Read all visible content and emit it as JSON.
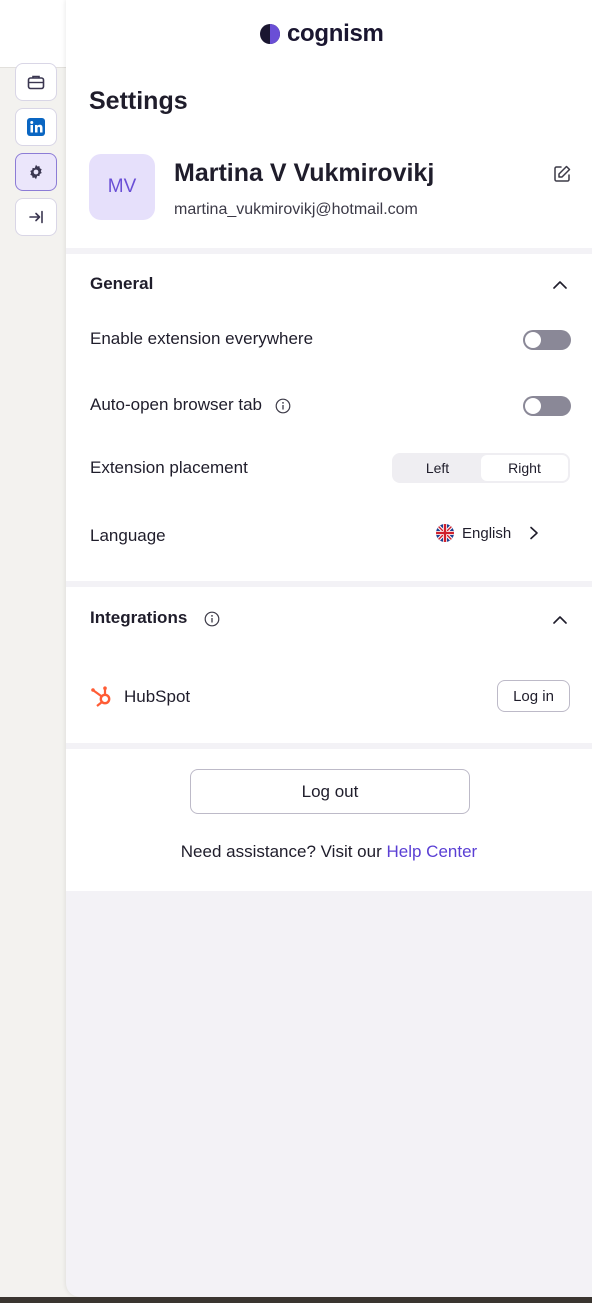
{
  "brand": {
    "name": "cognism",
    "accent": "#6a4fd6"
  },
  "toolbar": {
    "items": [
      {
        "icon": "briefcase-icon"
      },
      {
        "icon": "linkedin-icon"
      },
      {
        "icon": "gear-icon",
        "active": true
      },
      {
        "icon": "collapse-right-icon"
      }
    ]
  },
  "header": {
    "title": "Settings",
    "user": {
      "initials": "MV",
      "name": "Martina V Vukmirovikj",
      "email": "martina_vukmirovikj@hotmail.com"
    }
  },
  "general": {
    "title": "General",
    "enable_everywhere": {
      "label": "Enable extension everywhere",
      "on": false
    },
    "auto_open": {
      "label": "Auto-open browser tab",
      "on": false
    },
    "placement": {
      "label": "Extension placement",
      "options": [
        "Left",
        "Right"
      ],
      "selected": "Right"
    },
    "language": {
      "label": "Language",
      "value": "English"
    }
  },
  "integrations": {
    "title": "Integrations",
    "hubspot": {
      "name": "HubSpot",
      "login_label": "Log in"
    }
  },
  "footer": {
    "logout_label": "Log out",
    "assist_text": "Need assistance? Visit our",
    "help_link": "Help Center"
  }
}
